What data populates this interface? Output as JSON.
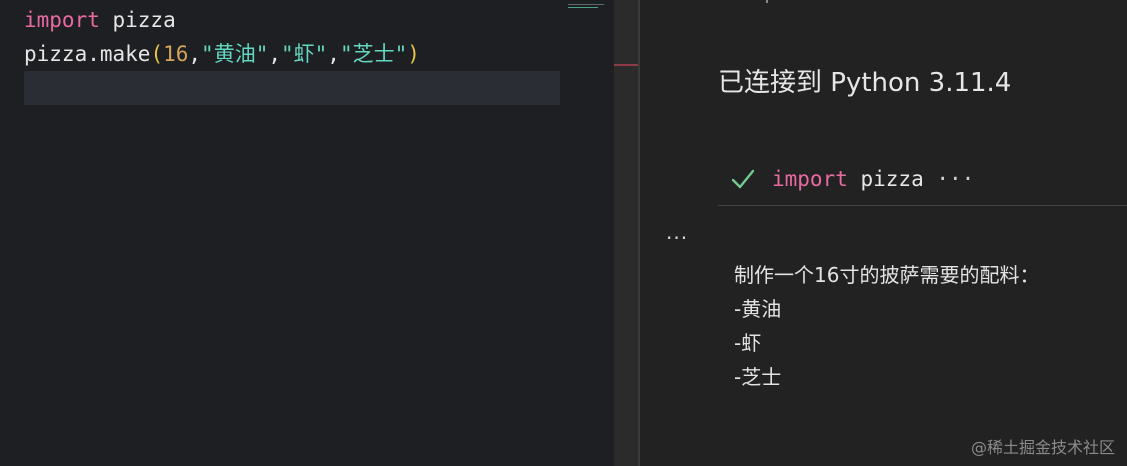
{
  "editor": {
    "line1": {
      "keyword": "import",
      "rest": " pizza"
    },
    "line2": {
      "prefix": "pizza.make",
      "open_paren": "(",
      "number": "16",
      "comma1": ",",
      "str1": "\"黄油\"",
      "comma2": ",",
      "str2": "\"虾\"",
      "comma3": ",",
      "str3": "\"芝士\"",
      "close_paren": ")"
    }
  },
  "output_pane": {
    "kernel_status": "已连接到 Python 3.11.4",
    "cell": {
      "keyword": "import",
      "rest": " pizza",
      "more": " ···",
      "status_icon": "check-icon"
    },
    "output_menu": "···",
    "output_lines": [
      "制作一个16寸的披萨需要的配料：",
      "-黄油",
      "-虾",
      "-芝士"
    ]
  },
  "watermark": "@稀土掘金技术社区",
  "colors": {
    "keyword": "#e86aa3",
    "number": "#d7a45d",
    "string": "#63d7c0",
    "success": "#73c991"
  }
}
